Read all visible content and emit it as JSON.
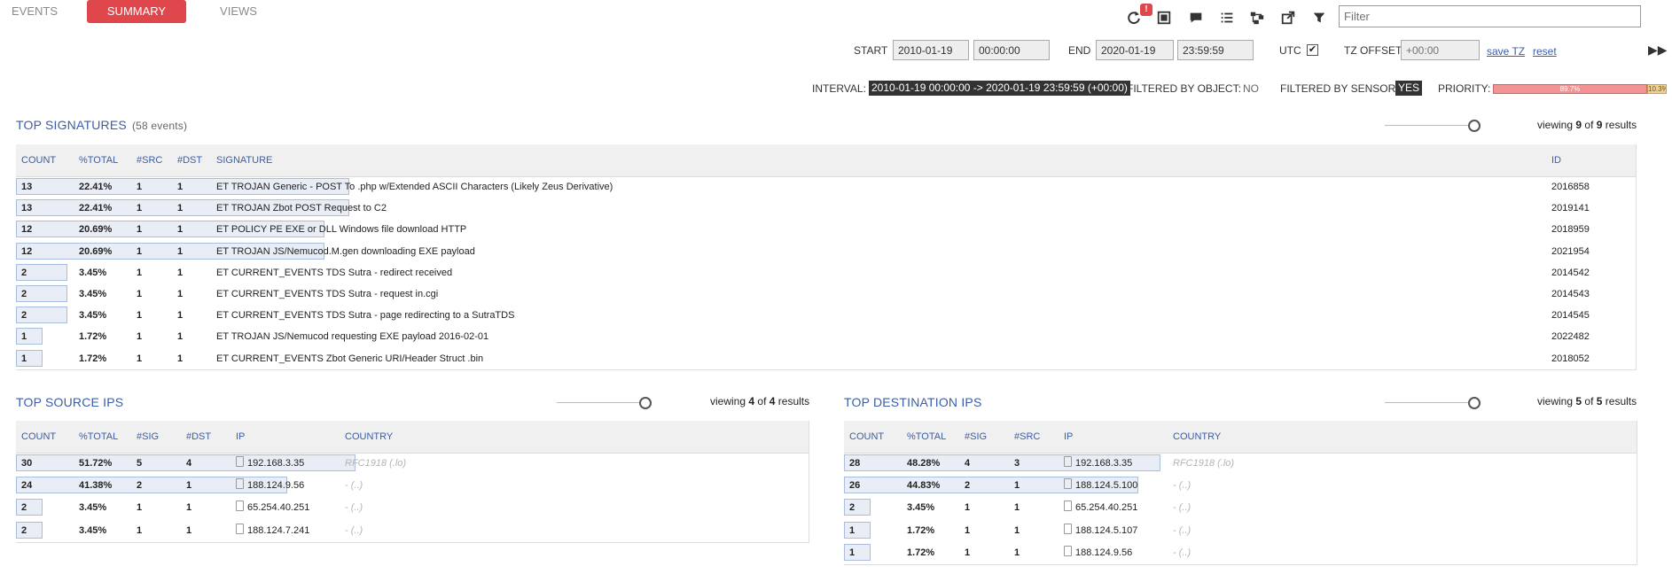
{
  "tabs": [
    {
      "label": "EVENTS",
      "active": false
    },
    {
      "label": "SUMMARY",
      "active": true
    },
    {
      "label": "VIEWS",
      "active": false
    }
  ],
  "toolbar": {
    "refresh_badge": "!",
    "icons": [
      "refresh-icon",
      "fullscreen-icon",
      "comment-icon",
      "list-icon",
      "share-icon",
      "external-link-icon",
      "filter-icon"
    ],
    "filter_placeholder": "Filter"
  },
  "time": {
    "start_label": "START",
    "start_date": "2010-01-19",
    "start_time": "00:00:00",
    "end_label": "END",
    "end_date": "2020-01-19",
    "end_time": "23:59:59",
    "utc_label": "UTC",
    "utc_checked": true,
    "tz_offset_label": "TZ OFFSET",
    "tz_offset_placeholder": "+00:00",
    "save_tz": "save TZ",
    "reset": "reset"
  },
  "status": {
    "interval_label": "INTERVAL:",
    "interval_value": "2010-01-19 00:00:00 -> 2020-01-19 23:59:59 (+00:00)",
    "filtered_object_label": "FILTERED BY OBJECT:",
    "filtered_object_value": "NO",
    "filtered_sensor_label": "FILTERED BY SENSOR:",
    "filtered_sensor_value": "YES",
    "priority_label": "PRIORITY:",
    "priority_high": "89.7%",
    "priority_low": "10.3%",
    "priority_high_color": "#f29494",
    "priority_low_color": "#f5d28c"
  },
  "signatures": {
    "title": "TOP SIGNATURES",
    "subtitle": "(58 events)",
    "viewing_prefix": "viewing",
    "viewing_shown": "9",
    "viewing_of": "of",
    "viewing_total": "9",
    "viewing_suffix": "results",
    "headers": [
      "COUNT",
      "%TOTAL",
      "#SRC",
      "#DST",
      "SIGNATURE",
      "ID"
    ],
    "rows": [
      {
        "count": "13",
        "pct": "22.41%",
        "frac": 0.2241,
        "src": "1",
        "dst": "1",
        "signature": "ET TROJAN Generic - POST To .php w/Extended ASCII Characters (Likely Zeus Derivative)",
        "id": "2016858"
      },
      {
        "count": "13",
        "pct": "22.41%",
        "frac": 0.2241,
        "src": "1",
        "dst": "1",
        "signature": "ET TROJAN Zbot POST Request to C2",
        "id": "2019141"
      },
      {
        "count": "12",
        "pct": "20.69%",
        "frac": 0.2069,
        "src": "1",
        "dst": "1",
        "signature": "ET POLICY PE EXE or DLL Windows file download HTTP",
        "id": "2018959"
      },
      {
        "count": "12",
        "pct": "20.69%",
        "frac": 0.2069,
        "src": "1",
        "dst": "1",
        "signature": "ET TROJAN JS/Nemucod.M.gen downloading EXE payload",
        "id": "2021954"
      },
      {
        "count": "2",
        "pct": "3.45%",
        "frac": 0.0345,
        "src": "1",
        "dst": "1",
        "signature": "ET CURRENT_EVENTS TDS Sutra - redirect received",
        "id": "2014542"
      },
      {
        "count": "2",
        "pct": "3.45%",
        "frac": 0.0345,
        "src": "1",
        "dst": "1",
        "signature": "ET CURRENT_EVENTS TDS Sutra - request in.cgi",
        "id": "2014543"
      },
      {
        "count": "2",
        "pct": "3.45%",
        "frac": 0.0345,
        "src": "1",
        "dst": "1",
        "signature": "ET CURRENT_EVENTS TDS Sutra - page redirecting to a SutraTDS",
        "id": "2014545"
      },
      {
        "count": "1",
        "pct": "1.72%",
        "frac": 0.0172,
        "src": "1",
        "dst": "1",
        "signature": "ET TROJAN JS/Nemucod requesting EXE payload 2016-02-01",
        "id": "2022482"
      },
      {
        "count": "1",
        "pct": "1.72%",
        "frac": 0.0172,
        "src": "1",
        "dst": "1",
        "signature": "ET CURRENT_EVENTS Zbot Generic URI/Header Struct .bin",
        "id": "2018052"
      }
    ]
  },
  "source_ips": {
    "title": "TOP SOURCE IPS",
    "viewing_prefix": "viewing",
    "viewing_shown": "4",
    "viewing_of": "of",
    "viewing_total": "4",
    "viewing_suffix": "results",
    "headers": [
      "COUNT",
      "%TOTAL",
      "#SIG",
      "#DST",
      "IP",
      "COUNTRY"
    ],
    "rows": [
      {
        "count": "30",
        "pct": "51.72%",
        "frac": 0.5172,
        "sig": "5",
        "other": "4",
        "ip": "192.168.3.35",
        "country": "RFC1918 (.lo)"
      },
      {
        "count": "24",
        "pct": "41.38%",
        "frac": 0.4138,
        "sig": "2",
        "other": "1",
        "ip": "188.124.9.56",
        "country": "- (..)"
      },
      {
        "count": "2",
        "pct": "3.45%",
        "frac": 0.0345,
        "sig": "1",
        "other": "1",
        "ip": "65.254.40.251",
        "country": "- (..)"
      },
      {
        "count": "2",
        "pct": "3.45%",
        "frac": 0.0345,
        "sig": "1",
        "other": "1",
        "ip": "188.124.7.241",
        "country": "- (..)"
      }
    ]
  },
  "dest_ips": {
    "title": "TOP DESTINATION IPS",
    "viewing_prefix": "viewing",
    "viewing_shown": "5",
    "viewing_of": "of",
    "viewing_total": "5",
    "viewing_suffix": "results",
    "headers": [
      "COUNT",
      "%TOTAL",
      "#SIG",
      "#SRC",
      "IP",
      "COUNTRY"
    ],
    "rows": [
      {
        "count": "28",
        "pct": "48.28%",
        "frac": 0.4828,
        "sig": "4",
        "other": "3",
        "ip": "192.168.3.35",
        "country": "RFC1918 (.lo)"
      },
      {
        "count": "26",
        "pct": "44.83%",
        "frac": 0.4483,
        "sig": "2",
        "other": "1",
        "ip": "188.124.5.100",
        "country": "- (..)"
      },
      {
        "count": "2",
        "pct": "3.45%",
        "frac": 0.0345,
        "sig": "1",
        "other": "1",
        "ip": "65.254.40.251",
        "country": "- (..)"
      },
      {
        "count": "1",
        "pct": "1.72%",
        "frac": 0.0172,
        "sig": "1",
        "other": "1",
        "ip": "188.124.5.107",
        "country": "- (..)"
      },
      {
        "count": "1",
        "pct": "1.72%",
        "frac": 0.0172,
        "sig": "1",
        "other": "1",
        "ip": "188.124.9.56",
        "country": "- (..)"
      }
    ]
  }
}
